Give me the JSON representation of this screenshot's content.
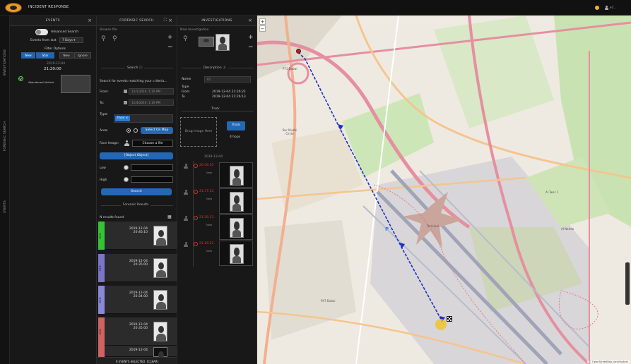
{
  "app": {
    "title": "INCIDENT RESPONSE",
    "user": "e7...",
    "colors": {
      "accent": "#1f66b5",
      "status_dot": "#f3b31b"
    }
  },
  "rail": {
    "items": [
      "INVESTIGATIONS",
      "FORENSIC SEARCH",
      "EVENTS"
    ]
  },
  "events": {
    "title": "EVENTS",
    "advanced_search_label": "Advanced Search",
    "events_from_label": "Events from last",
    "events_from_value": "7 Days",
    "filter_options_label": "Filter Options",
    "filters": [
      "New",
      "Star",
      "New",
      "Ignore"
    ],
    "item": {
      "date": "2019-12-04",
      "time": "21:20:00",
      "label": "Abandoned Vehicle"
    }
  },
  "forensic": {
    "title": "FORENSIC SEARCH",
    "browse_label": "Browse file",
    "search_section": "Search",
    "search_hint": "Search for events matching your criteria...",
    "from_label": "From:",
    "from_value": "12/1/2019, 1:19 PM",
    "to_label": "To:",
    "to_value": "12/4/2019, 1:19 PM",
    "type_label": "Type:",
    "type_value": "Face",
    "area_label": "Area:",
    "select_on_map": "Select On Map",
    "face_image_label": "Face Image:",
    "choose_file": "Choose a file",
    "object_button": "[Object Object]",
    "low_label": "Low",
    "high_label": "High",
    "search_button": "Search",
    "results_section": "Forensic Results",
    "results_count": "N results found",
    "results": [
      {
        "pct": "90%",
        "date": "2019-12-04",
        "time": "20:46:10",
        "color": "#35c435"
      },
      {
        "pct": "70%",
        "date": "2019-12-04",
        "time": "20:35:00",
        "color": "#7b74c9"
      },
      {
        "pct": "60%",
        "date": "2019-12-04",
        "time": "20:34:00",
        "color": "#8a87d6"
      },
      {
        "pct": "50%",
        "date": "2019-12-04",
        "time": "20:35:00",
        "color": "#d16262"
      },
      {
        "pct": "",
        "date": "2019-12-04",
        "time": "",
        "color": "#d16262"
      }
    ],
    "events_selected": "0 EVENTS SELECTED",
    "clear_label": "[CLEAR]"
  },
  "investigations": {
    "title": "INVESTIGATIONS",
    "new_label": "New Investigation",
    "description_section": "Description",
    "name_label": "Name",
    "name_value": "01",
    "type_label": "Type",
    "from_label": "From",
    "from_value": "2019-12-04 21:26:22",
    "to_label": "To",
    "to_value": "2019-12-04 21:26:13",
    "track_section": "Track",
    "drag_text": "Drag Image Here",
    "track_button": "Track",
    "hops": "4 hops",
    "tl_date": "2019-12-04",
    "timeline": [
      {
        "time": "20:46:10",
        "tag": "New"
      },
      {
        "time": "21:37:22",
        "tag": "New"
      },
      {
        "time": "21:26:13",
        "tag": "New"
      },
      {
        "time": "21:26:22",
        "tag": "New"
      }
    ]
  },
  "map": {
    "labels": [
      "P71 Dubai",
      "Bur Mudhi Circle",
      "Terminal",
      "Al Twar 1",
      "Al Nahda",
      "P",
      "P47 Dubai"
    ],
    "attribution": "© OpenStreetMap contributors",
    "zoom_in": "+",
    "zoom_out": "−",
    "colors": {
      "path": "#1a2ec9",
      "start": "#b3242a",
      "end": "#f2c21b"
    }
  }
}
